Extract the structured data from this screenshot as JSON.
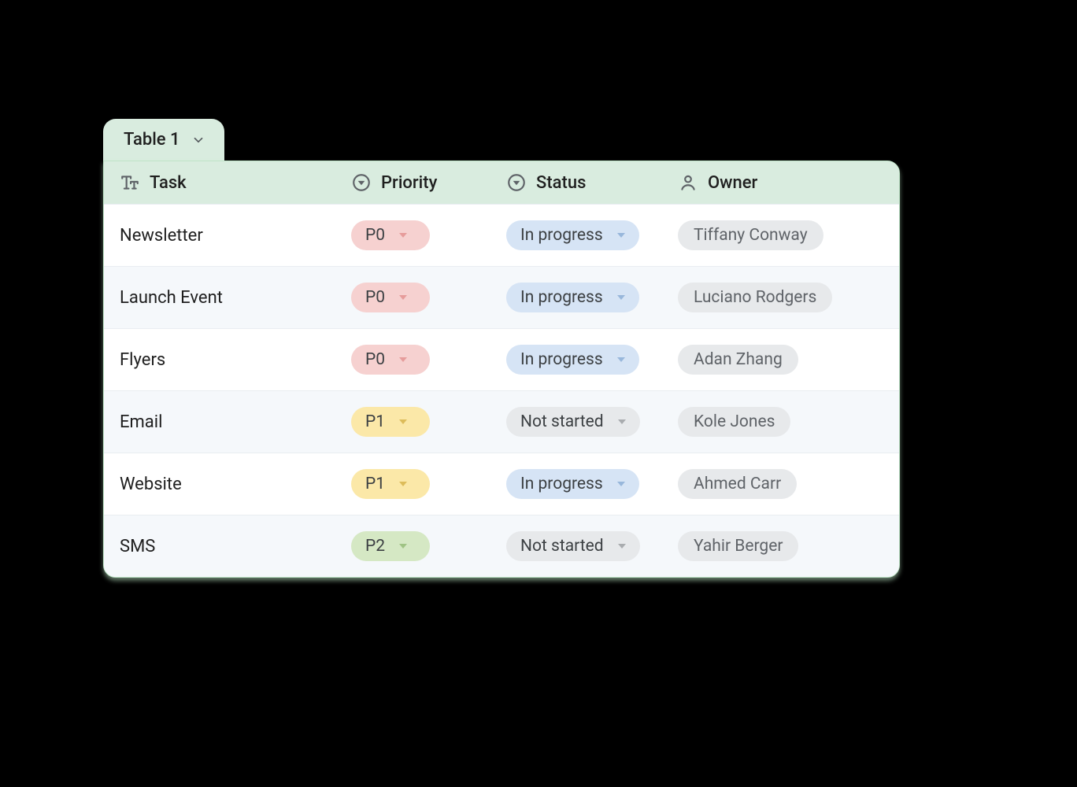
{
  "tab": {
    "label": "Table 1"
  },
  "columns": {
    "task": {
      "label": "Task"
    },
    "priority": {
      "label": "Priority"
    },
    "status": {
      "label": "Status"
    },
    "owner": {
      "label": "Owner"
    }
  },
  "priority_styles": {
    "P0": "p-P0",
    "P1": "p-P1",
    "P2": "p-P2"
  },
  "status_styles": {
    "In progress": "s-inprogress",
    "Not started": "s-notstarted"
  },
  "rows": [
    {
      "task": "Newsletter",
      "priority": "P0",
      "status": "In progress",
      "owner": "Tiffany Conway"
    },
    {
      "task": "Launch Event",
      "priority": "P0",
      "status": "In progress",
      "owner": "Luciano Rodgers"
    },
    {
      "task": "Flyers",
      "priority": "P0",
      "status": "In progress",
      "owner": "Adan Zhang"
    },
    {
      "task": "Email",
      "priority": "P1",
      "status": "Not started",
      "owner": "Kole Jones"
    },
    {
      "task": "Website",
      "priority": "P1",
      "status": "In progress",
      "owner": "Ahmed Carr"
    },
    {
      "task": "SMS",
      "priority": "P2",
      "status": "Not started",
      "owner": "Yahir Berger"
    }
  ]
}
